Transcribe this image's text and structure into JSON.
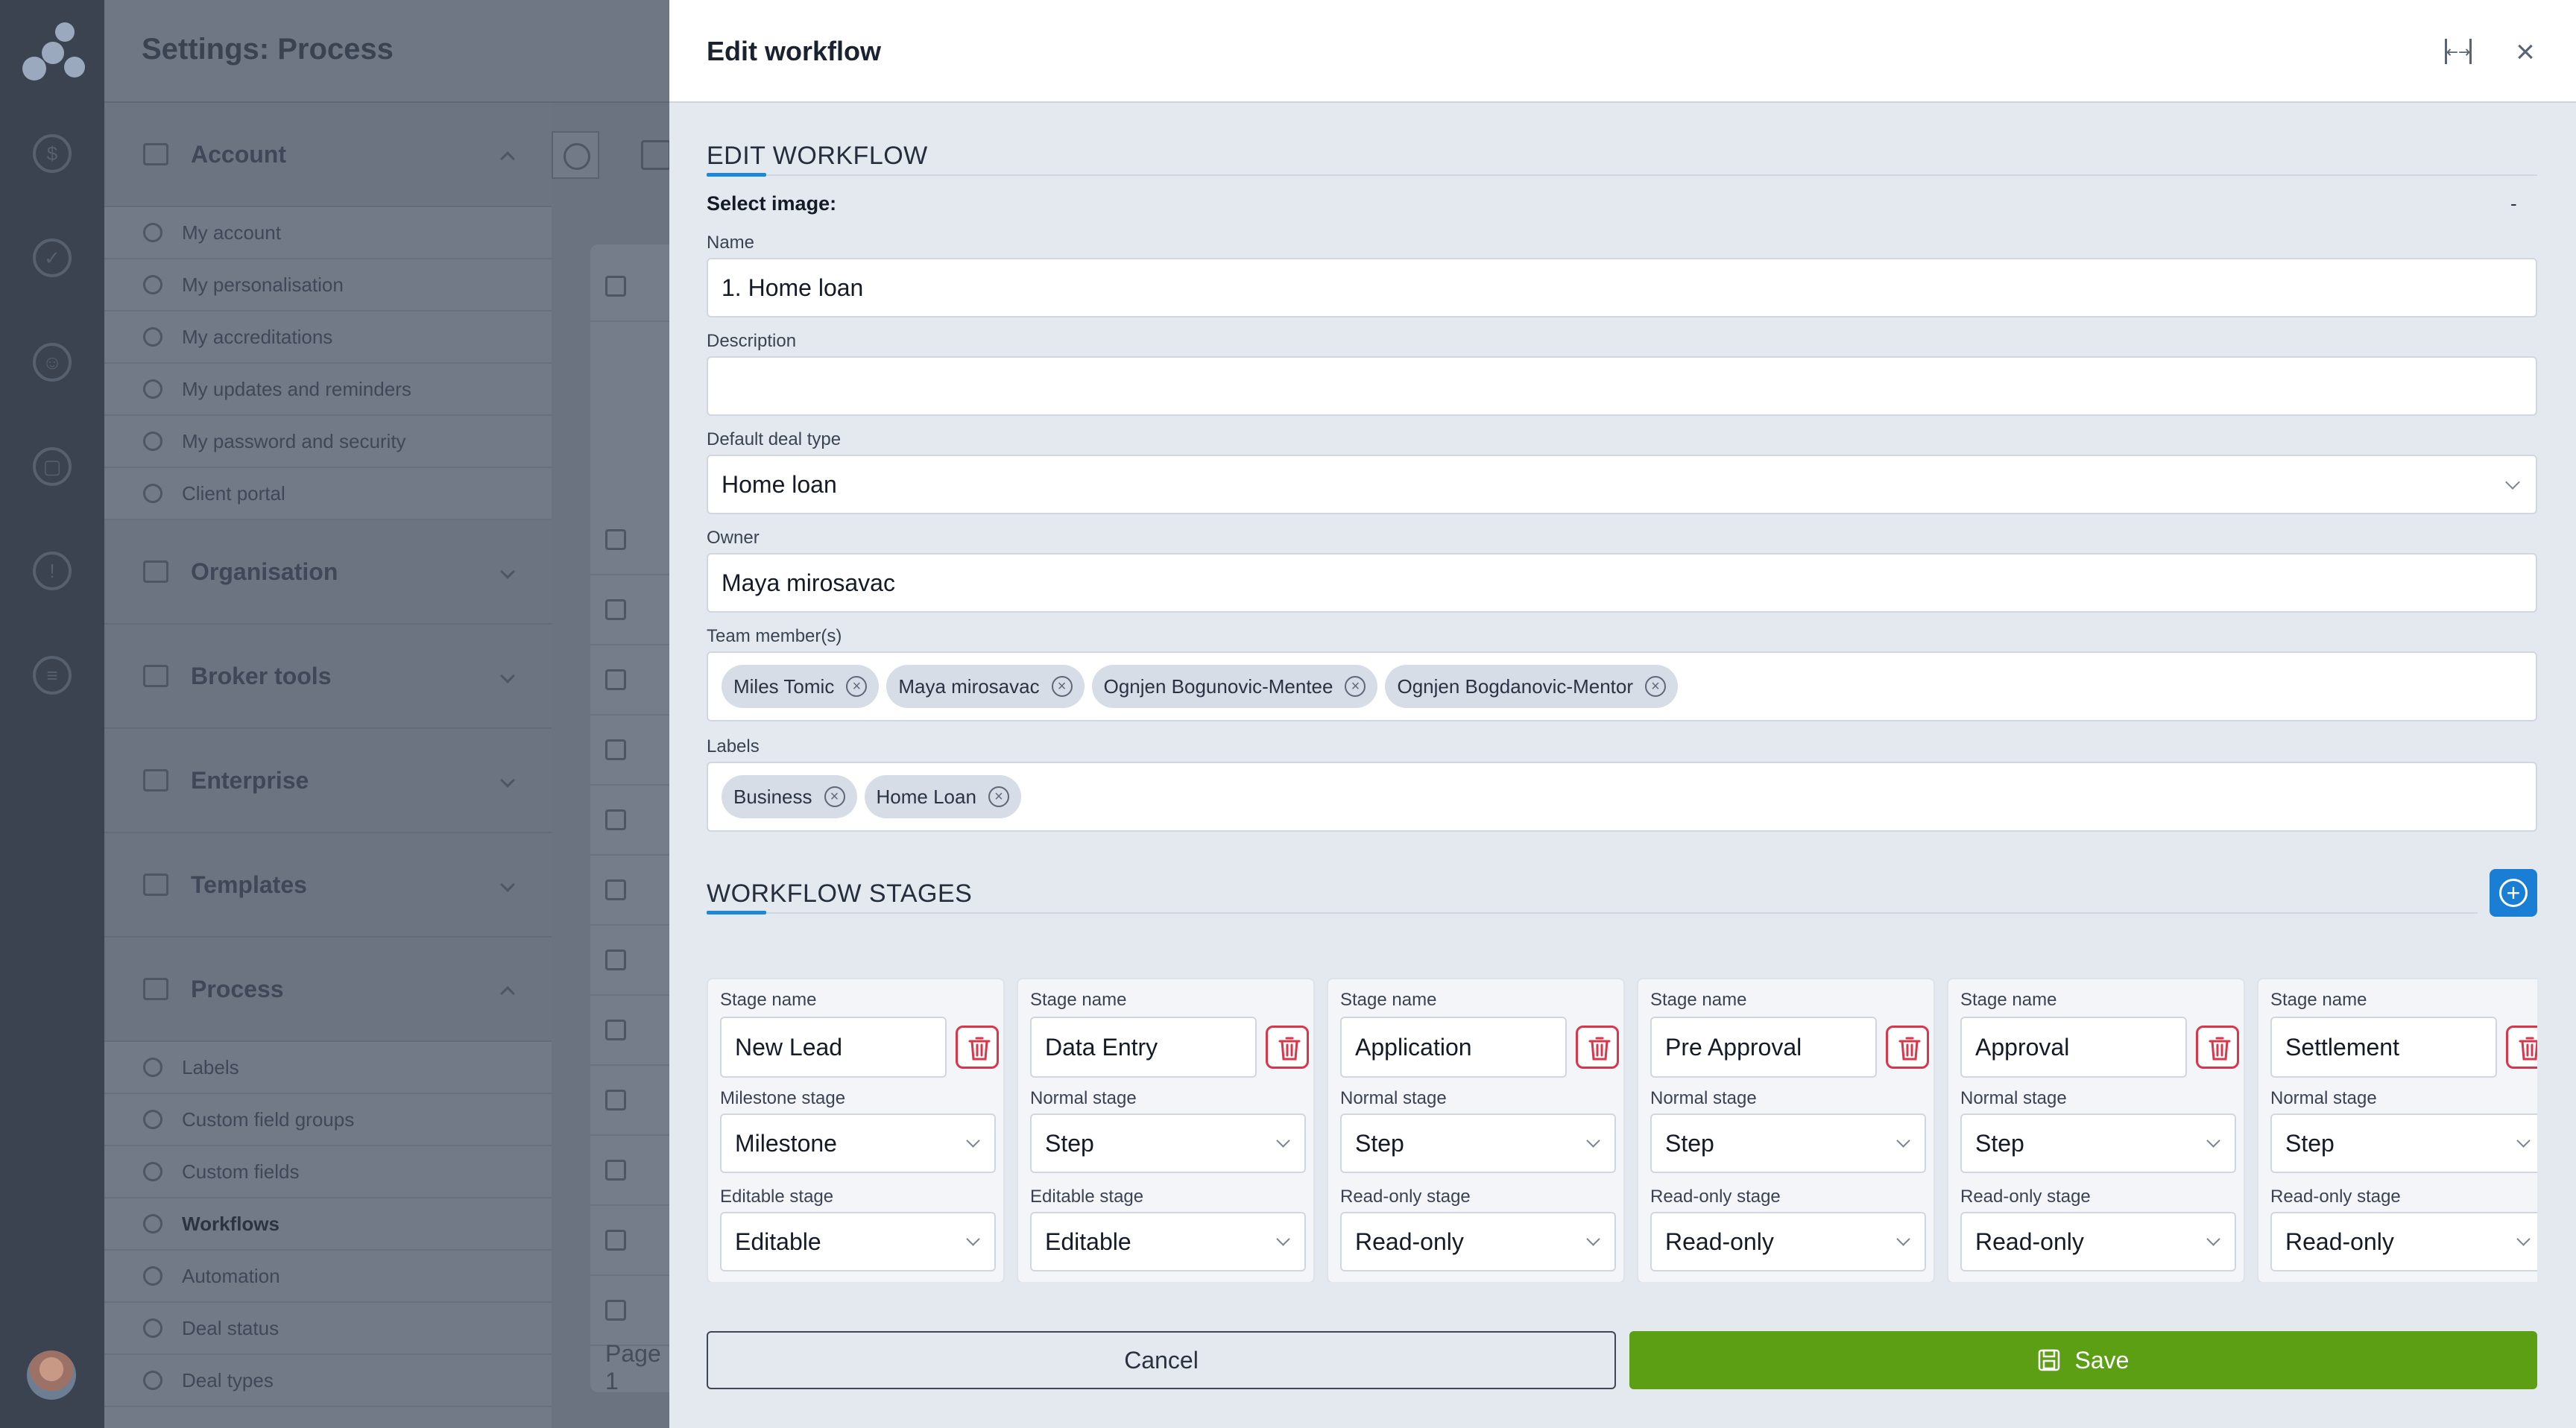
{
  "app": {
    "page_title": "Settings: Process",
    "rail_icons": [
      "dollar-icon",
      "check-circle-icon",
      "people-icon",
      "box-icon",
      "lightbulb-icon",
      "layers-icon"
    ]
  },
  "sidebar": {
    "groups": [
      {
        "label": "Account",
        "icon": "id-card-icon",
        "expanded": true,
        "items": [
          "My account",
          "My personalisation",
          "My accreditations",
          "My updates and reminders",
          "My password and security",
          "Client portal"
        ]
      },
      {
        "label": "Organisation",
        "icon": "building-icon",
        "expanded": false,
        "items": []
      },
      {
        "label": "Broker tools",
        "icon": "briefcase-icon",
        "expanded": false,
        "items": []
      },
      {
        "label": "Enterprise",
        "icon": "enterprise-icon",
        "expanded": false,
        "items": []
      },
      {
        "label": "Templates",
        "icon": "template-icon",
        "expanded": false,
        "items": []
      },
      {
        "label": "Process",
        "icon": "gear-icon",
        "expanded": true,
        "items": [
          "Labels",
          "Custom field groups",
          "Custom fields",
          "Workflows",
          "Automation",
          "Deal status",
          "Deal types"
        ]
      }
    ],
    "active_item": "Workflows"
  },
  "main": {
    "page_label": "Page 1"
  },
  "drawer": {
    "title": "Edit workflow",
    "section_edit": "EDIT WORKFLOW",
    "select_image_label": "Select image:",
    "select_image_value": "-",
    "name_label": "Name",
    "name_value": "1. Home loan",
    "description_label": "Description",
    "description_value": "",
    "deal_type_label": "Default deal type",
    "deal_type_value": "Home loan",
    "owner_label": "Owner",
    "owner_value": "Maya mirosavac",
    "team_label": "Team member(s)",
    "team_members": [
      "Miles Tomic",
      "Maya mirosavac",
      "Ognjen Bogunovic-Mentee",
      "Ognjen Bogdanovic-Mentor"
    ],
    "labels_label": "Labels",
    "labels": [
      "Business",
      "Home Loan"
    ],
    "section_stages": "WORKFLOW STAGES",
    "stage_name_label": "Stage name",
    "stages": [
      {
        "name": "New Lead",
        "type_label": "Milestone stage",
        "type": "Milestone",
        "edit_label": "Editable stage",
        "edit": "Editable"
      },
      {
        "name": "Data Entry",
        "type_label": "Normal stage",
        "type": "Step",
        "edit_label": "Editable stage",
        "edit": "Editable"
      },
      {
        "name": "Application",
        "type_label": "Normal stage",
        "type": "Step",
        "edit_label": "Read-only stage",
        "edit": "Read-only"
      },
      {
        "name": "Pre Approval",
        "type_label": "Normal stage",
        "type": "Step",
        "edit_label": "Read-only stage",
        "edit": "Read-only"
      },
      {
        "name": "Approval",
        "type_label": "Normal stage",
        "type": "Step",
        "edit_label": "Read-only stage",
        "edit": "Read-only"
      },
      {
        "name": "Settlement",
        "type_label": "Normal stage",
        "type": "Step",
        "edit_label": "Read-only stage",
        "edit": "Read-only"
      }
    ],
    "cancel_label": "Cancel",
    "save_label": "Save"
  },
  "colors": {
    "accent": "#1a7fd4",
    "save": "#5c9f14",
    "danger": "#d9364a"
  }
}
